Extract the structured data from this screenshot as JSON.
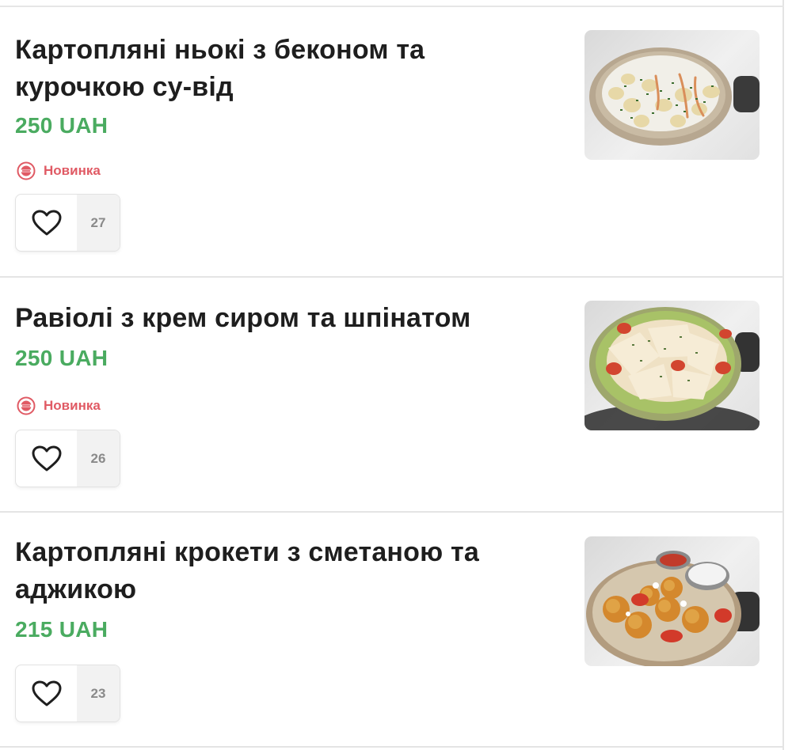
{
  "currency": "UAH",
  "colors": {
    "price": "#4aab60",
    "badge": "#e05a64",
    "title": "#1e1e1e"
  },
  "items": [
    {
      "title_line1": "Картопляні ньокі з беконом та",
      "title_line2": "курочкою су-від",
      "price": "250 UAH",
      "badge": "Новинка",
      "likes": "27",
      "icon": "heart-icon"
    },
    {
      "title_line1": "Равіолі з крем сиром та шпінатом",
      "title_line2": "",
      "price": "250 UAH",
      "badge": "Новинка",
      "likes": "26",
      "icon": "heart-icon"
    },
    {
      "title_line1": "Картопляні крокети з сметаною та",
      "title_line2": "аджикою",
      "price": "215 UAH",
      "badge": "",
      "likes": "23",
      "icon": "heart-icon"
    }
  ]
}
